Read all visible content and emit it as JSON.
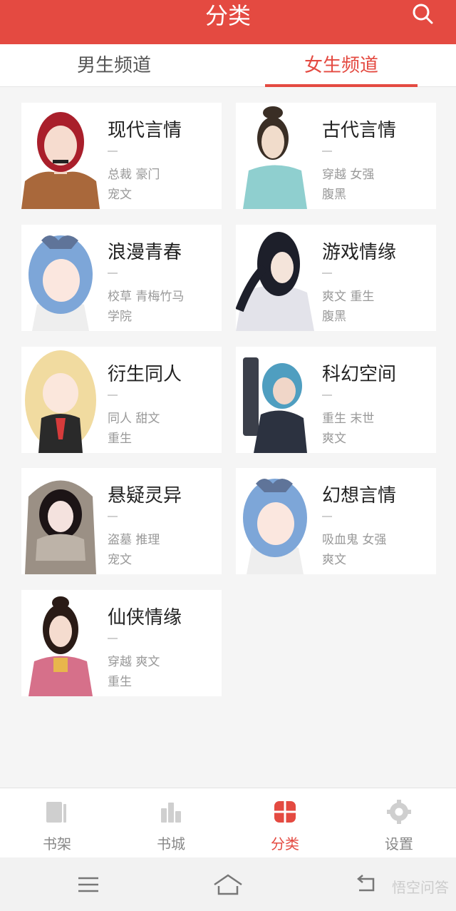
{
  "header": {
    "title": "分类",
    "search_icon": "search-icon"
  },
  "tabs": [
    {
      "label": "男生频道",
      "active": false
    },
    {
      "label": "女生频道",
      "active": true
    }
  ],
  "categories": [
    {
      "name": "现代言情",
      "tags_line1": "总裁  豪门",
      "tags_line2": "宠文"
    },
    {
      "name": "古代言情",
      "tags_line1": "穿越  女强",
      "tags_line2": "腹黑"
    },
    {
      "name": "浪漫青春",
      "tags_line1": "校草  青梅竹马",
      "tags_line2": "学院"
    },
    {
      "name": "游戏情缘",
      "tags_line1": "爽文  重生",
      "tags_line2": "腹黑"
    },
    {
      "name": "衍生同人",
      "tags_line1": "同人  甜文",
      "tags_line2": "重生"
    },
    {
      "name": "科幻空间",
      "tags_line1": "重生  末世",
      "tags_line2": "爽文"
    },
    {
      "name": "悬疑灵异",
      "tags_line1": "盗墓  推理",
      "tags_line2": "宠文"
    },
    {
      "name": "幻想言情",
      "tags_line1": "吸血鬼  女强",
      "tags_line2": "爽文"
    },
    {
      "name": "仙侠情缘",
      "tags_line1": "穿越  爽文",
      "tags_line2": "重生"
    }
  ],
  "bottom_nav": [
    {
      "label": "书架",
      "icon": "bookshelf-icon",
      "active": false
    },
    {
      "label": "书城",
      "icon": "bookstore-icon",
      "active": false
    },
    {
      "label": "分类",
      "icon": "category-icon",
      "active": true
    },
    {
      "label": "设置",
      "icon": "settings-icon",
      "active": false
    }
  ],
  "system_bar": {
    "watermark": "悟空问答"
  },
  "colors": {
    "accent": "#e44a41",
    "background": "#f5f5f5",
    "tag_text": "#999999"
  }
}
